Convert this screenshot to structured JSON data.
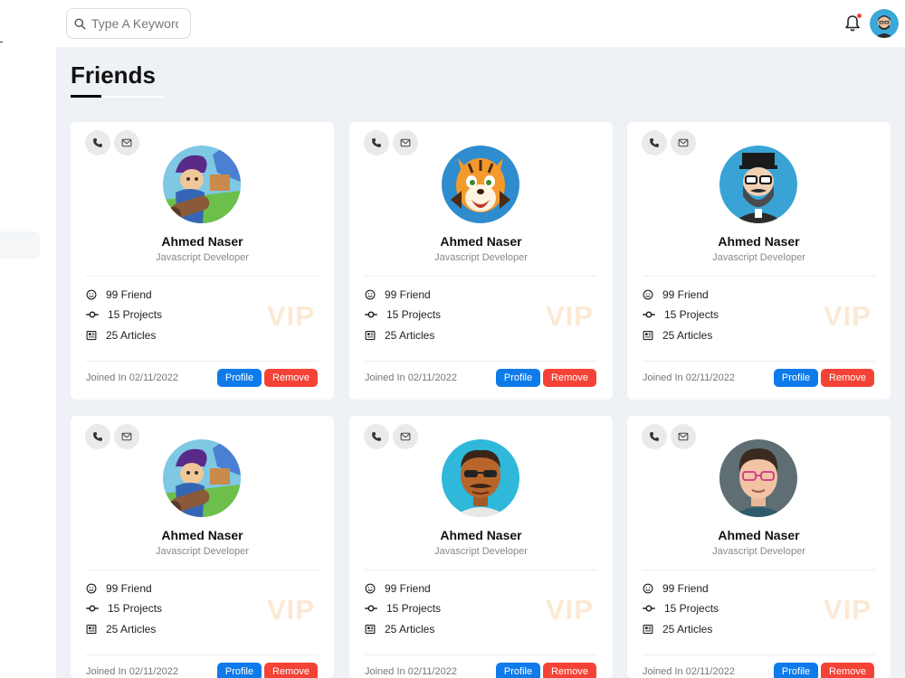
{
  "search": {
    "placeholder": "Type A Keyword"
  },
  "page": {
    "title": "Friends"
  },
  "vip_label": "VIP",
  "colors": {
    "primary": "#0f7bea",
    "danger": "#f44336",
    "vip": "#fbe9d4"
  },
  "icons": {
    "phone": "phone-icon",
    "mail": "mail-icon",
    "friends": "smile-icon",
    "projects": "commit-icon",
    "articles": "newspaper-icon",
    "search": "search-icon",
    "notification": "bell-icon"
  },
  "friends": [
    {
      "avatar": "boy-with-cannon",
      "name": "Ahmed Naser",
      "role": "Javascript Developer",
      "stats": {
        "friends": "99 Friend",
        "projects": "15 Projects",
        "articles": "25 Articles"
      },
      "joined": "Joined In 02/11/2022",
      "profile_label": "Profile",
      "remove_label": "Remove"
    },
    {
      "avatar": "tiger",
      "name": "Ahmed Naser",
      "role": "Javascript Developer",
      "stats": {
        "friends": "99 Friend",
        "projects": "15 Projects",
        "articles": "25 Articles"
      },
      "joined": "Joined In 02/11/2022",
      "profile_label": "Profile",
      "remove_label": "Remove"
    },
    {
      "avatar": "bearded-man-hat",
      "name": "Ahmed Naser",
      "role": "Javascript Developer",
      "stats": {
        "friends": "99 Friend",
        "projects": "15 Projects",
        "articles": "25 Articles"
      },
      "joined": "Joined In 02/11/2022",
      "profile_label": "Profile",
      "remove_label": "Remove"
    },
    {
      "avatar": "boy-with-cannon",
      "name": "Ahmed Naser",
      "role": "Javascript Developer",
      "stats": {
        "friends": "99 Friend",
        "projects": "15 Projects",
        "articles": "25 Articles"
      },
      "joined": "Joined In 02/11/2022",
      "profile_label": "Profile",
      "remove_label": "Remove"
    },
    {
      "avatar": "man-sunglasses",
      "name": "Ahmed Naser",
      "role": "Javascript Developer",
      "stats": {
        "friends": "99 Friend",
        "projects": "15 Projects",
        "articles": "25 Articles"
      },
      "joined": "Joined In 02/11/2022",
      "profile_label": "Profile",
      "remove_label": "Remove"
    },
    {
      "avatar": "man-glasses",
      "name": "Ahmed Naser",
      "role": "Javascript Developer",
      "stats": {
        "friends": "99 Friend",
        "projects": "15 Projects",
        "articles": "25 Articles"
      },
      "joined": "Joined In 02/11/2022",
      "profile_label": "Profile",
      "remove_label": "Remove"
    }
  ]
}
